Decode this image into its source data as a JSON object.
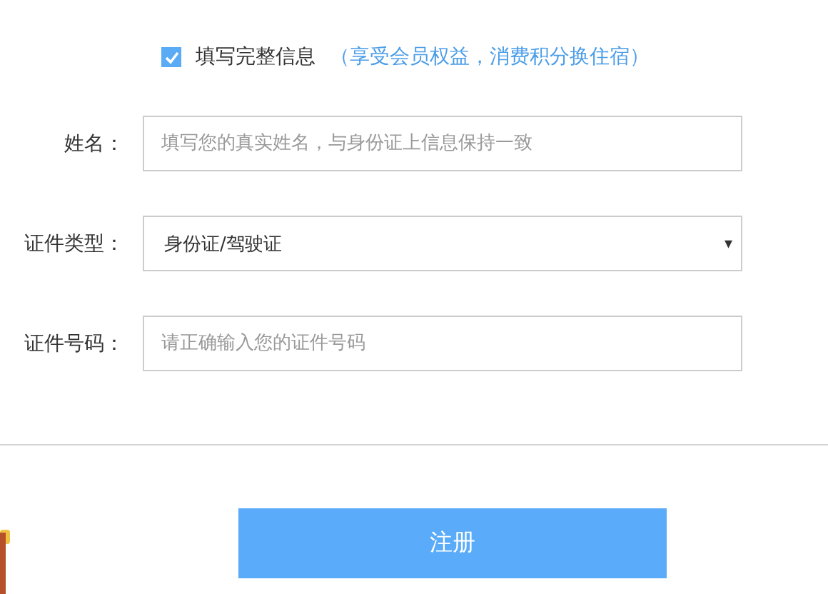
{
  "consent": {
    "checked": true,
    "label": "填写完整信息",
    "note": "（享受会员权益，消费积分换住宿）"
  },
  "fields": [
    {
      "kind": "text",
      "label": "姓名：",
      "placeholder": "填写您的真实姓名，与身份证上信息保持一致"
    },
    {
      "kind": "select",
      "label": "证件类型：",
      "value": "身份证/驾驶证",
      "caret": "▾"
    },
    {
      "kind": "text",
      "label": "证件号码：",
      "placeholder": "请正确输入您的证件号码"
    }
  ],
  "submit": "注册"
}
